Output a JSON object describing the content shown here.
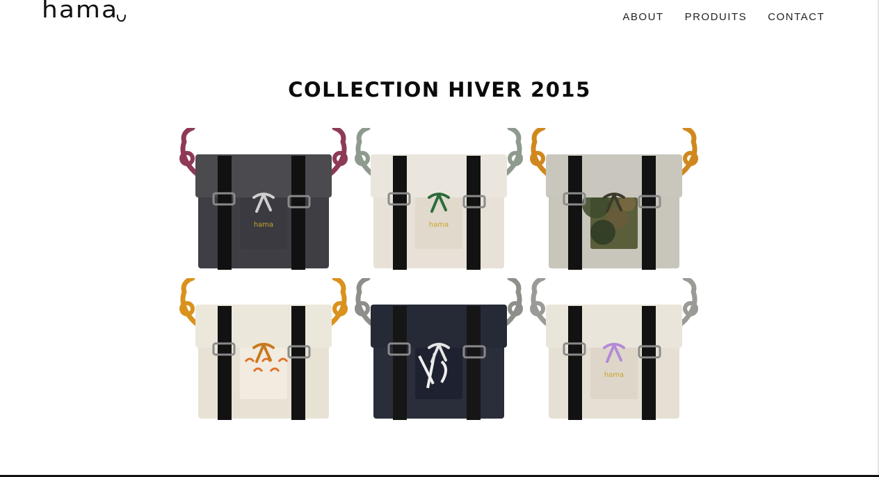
{
  "header": {
    "logo": "hama",
    "nav": [
      {
        "label": "ABOUT"
      },
      {
        "label": "PRODUITS"
      },
      {
        "label": "CONTACT"
      }
    ]
  },
  "main": {
    "title": "COLLECTION HIVER 2015",
    "products": [
      {
        "rope": "#8e3a56",
        "flap": "#4a4a4f",
        "body": "#3e3e44",
        "pocket": "#3a3a40",
        "strap": "#111111",
        "tie": "#cfcfcf",
        "print": "plain",
        "label": "hama"
      },
      {
        "rope": "#8f9a8f",
        "flap": "#ebe6dd",
        "body": "#e7e1d7",
        "pocket": "#e0d9cc",
        "strap": "#121212",
        "tie": "#2d6b3b",
        "print": "plain",
        "label": "hama"
      },
      {
        "rope": "#d0881e",
        "flap": "#c9c7bd",
        "body": "#c8c5ba",
        "pocket": "#5a5e3a",
        "strap": "#121212",
        "tie": "#3d3a2a",
        "print": "camo",
        "label": ""
      },
      {
        "rope": "#d9921c",
        "flap": "#ece7db",
        "body": "#e8e2d5",
        "pocket": "#f1ebe0",
        "strap": "#121212",
        "tie": "#c77a1e",
        "print": "orange",
        "label": ""
      },
      {
        "rope": "#8e8e8a",
        "flap": "#262a36",
        "body": "#2a2e3a",
        "pocket": "#1e2230",
        "strap": "#161616",
        "tie": "#e5e5e5",
        "print": "bw",
        "label": ""
      },
      {
        "rope": "#9a9a96",
        "flap": "#eae5da",
        "body": "#e6e0d4",
        "pocket": "#ddd6c9",
        "strap": "#121212",
        "tie": "#b48ad6",
        "print": "plain",
        "label": "hama"
      }
    ]
  }
}
